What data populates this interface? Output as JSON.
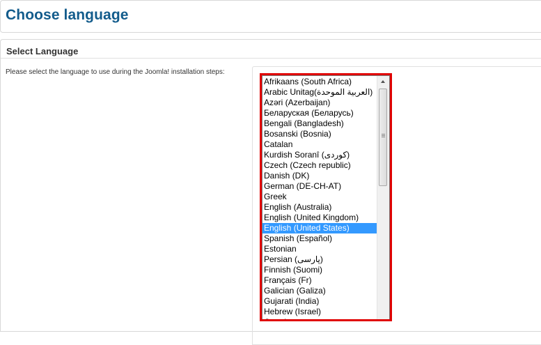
{
  "header": {
    "title": "Choose language"
  },
  "section": {
    "title": "Select Language",
    "instructions": "Please select the language to use during the Joomla! installation steps:"
  },
  "language_list": {
    "selected": "English (United States)",
    "options": [
      "Afrikaans (South Africa)",
      "Arabic Unitag(العربية الموحدة)",
      "Azəri (Azerbaijan)",
      "Беларуская (Беларусь)",
      "Bengali (Bangladesh)",
      "Bosanski (Bosnia)",
      "Catalan",
      "Kurdish Soranî (کوردی)",
      "Czech (Czech republic)",
      "Danish (DK)",
      "German (DE-CH-AT)",
      "Greek",
      "English (Australia)",
      "English (United Kingdom)",
      "English (United States)",
      "Spanish (Español)",
      "Estonian",
      "Persian (پارسی)",
      "Finnish (Suomi)",
      "Français (Fr)",
      "Galician (Galiza)",
      "Gujarati (India)",
      "Hebrew (Israel)",
      "Croatian"
    ]
  },
  "colors": {
    "title": "#135c8c",
    "highlight_frame": "#e00000",
    "selection": "#3399ff"
  }
}
